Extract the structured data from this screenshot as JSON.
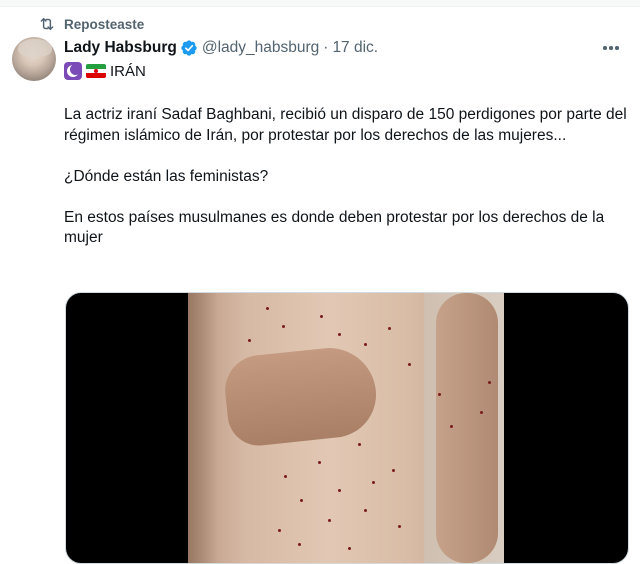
{
  "repost": {
    "label": "Reposteaste",
    "icon": "repost-icon"
  },
  "author": {
    "display_name": "Lady Habsburg",
    "handle": "@lady_habsburg",
    "separator": "·",
    "date": "17 dic.",
    "verified_icon": "verified-badge-icon",
    "bio_text": "IRÁN",
    "bio_icons": [
      "crescent-badge-icon",
      "iran-flag-icon"
    ]
  },
  "tweet": {
    "paragraphs": [
      "La actriz iraní Sadaf Baghbani, recibió un disparo de 150 perdigones por parte del régimen islámico de Irán, por protestar por los derechos de las mujeres...",
      "¿Dónde están las feministas?",
      "En estos países musulmanes es donde deben protestar por los derechos de la mujer"
    ]
  },
  "menu": {
    "icon": "more-options-icon"
  },
  "colors": {
    "text": "#0f1419",
    "secondary": "#536471",
    "verified": "#1d9bf0",
    "border": "#cfd9de"
  }
}
